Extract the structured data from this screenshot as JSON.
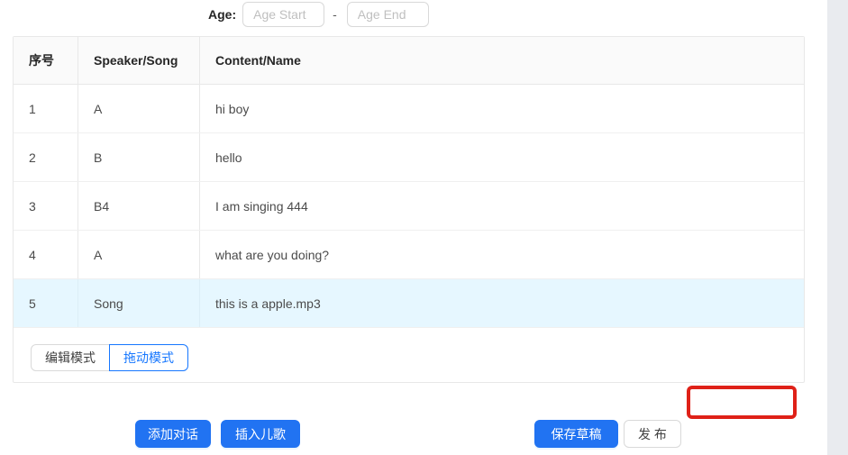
{
  "age_filter": {
    "label": "Age:",
    "start_placeholder": "Age Start",
    "separator": "-",
    "end_placeholder": "Age End"
  },
  "table": {
    "columns": [
      "序号",
      "Speaker/Song",
      "Content/Name"
    ],
    "rows": [
      {
        "index": "1",
        "speaker": "A",
        "content": "hi boy"
      },
      {
        "index": "2",
        "speaker": "B",
        "content": "hello"
      },
      {
        "index": "3",
        "speaker": "B4",
        "content": "I am singing 444"
      },
      {
        "index": "4",
        "speaker": "A",
        "content": "what are you doing?"
      },
      {
        "index": "5",
        "speaker": "Song",
        "content": "this is a apple.mp3"
      }
    ],
    "selected_row_index": "5"
  },
  "mode_toggle": {
    "edit_label": "编辑模式",
    "drag_label": "拖动模式",
    "selected": "拖动模式"
  },
  "actions": {
    "add_dialogue": "添加对话",
    "insert_song": "插入儿歌",
    "save_draft": "保存草稿",
    "publish": "发 布"
  },
  "colors": {
    "primary_blue": "#2173f2",
    "selected_row_bg": "#e6f7ff",
    "highlight_border_red": "#df2118",
    "header_bg": "#fafafa"
  }
}
